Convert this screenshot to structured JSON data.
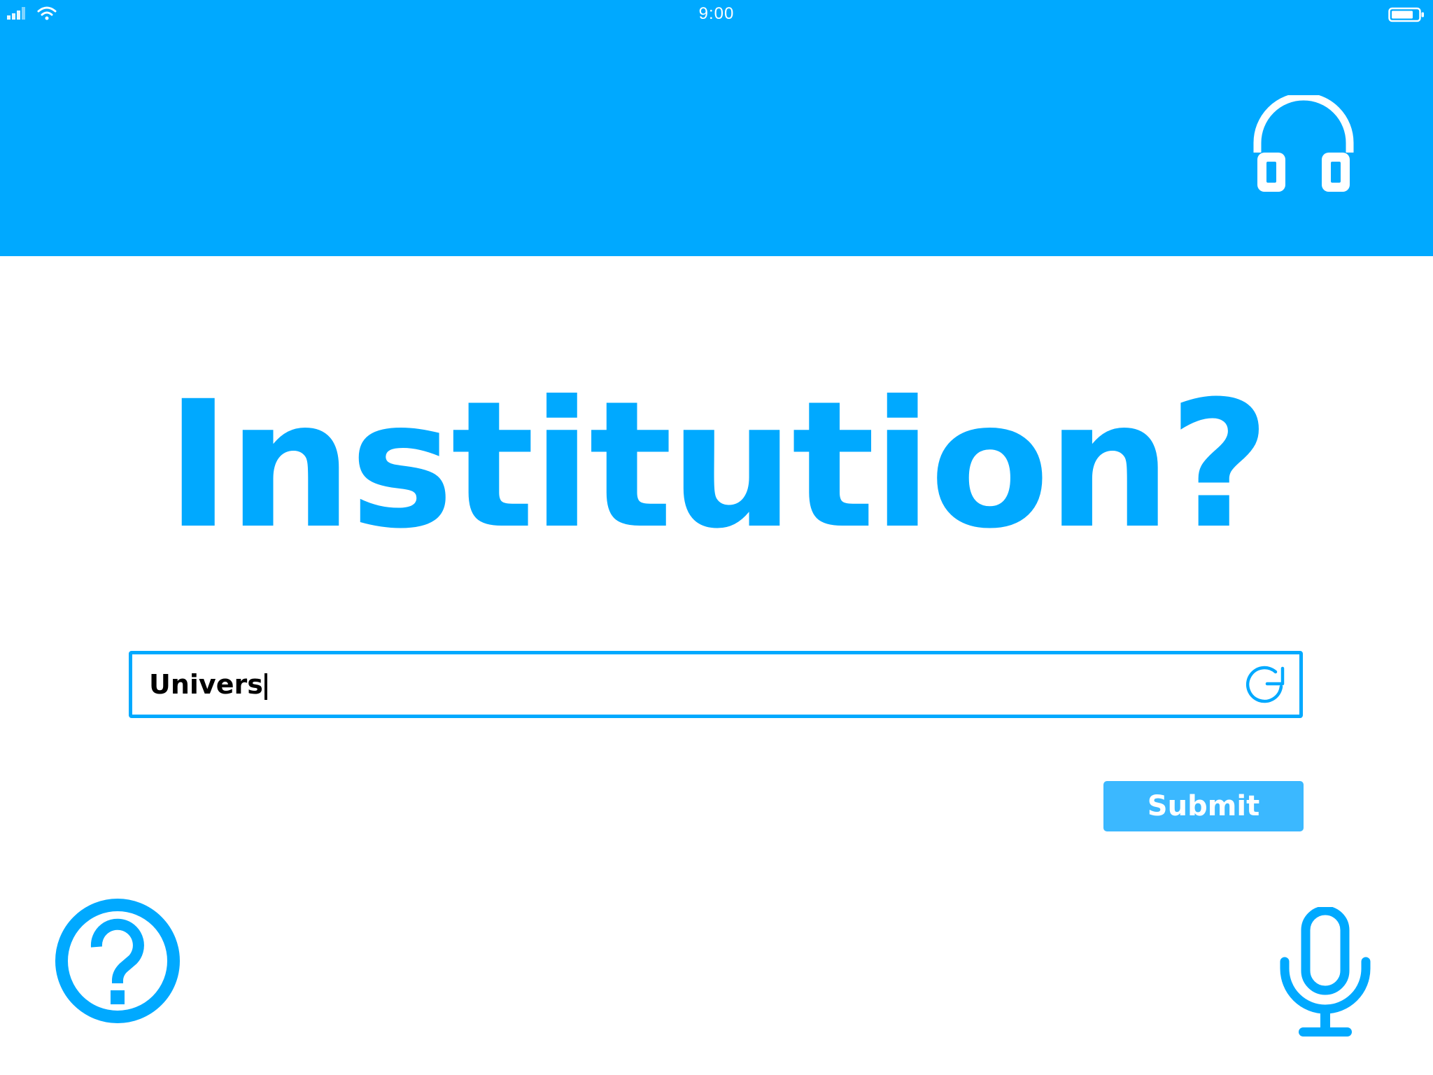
{
  "status_bar": {
    "time": "9:00"
  },
  "header": {
    "audio_icon": "headphones-icon"
  },
  "main": {
    "question": "Institution?",
    "search": {
      "value": "Univers",
      "refresh_icon": "refresh-icon"
    },
    "submit_label": "Submit"
  },
  "footer": {
    "help_icon": "help-icon",
    "voice_icon": "microphone-icon"
  },
  "colors": {
    "accent": "#00a9ff",
    "button": "#3bb8ff",
    "background": "#ffffff"
  }
}
